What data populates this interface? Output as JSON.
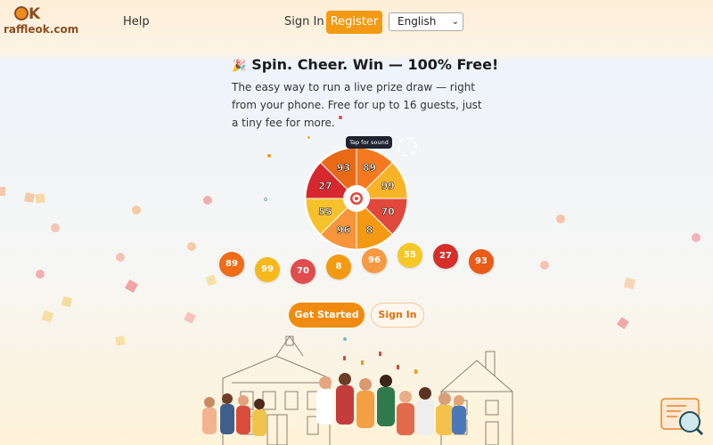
{
  "header": {
    "logo_text": "raffleok.com",
    "logo_mark": "K",
    "help_label": "Help",
    "signin_label": "Sign In",
    "register_label": "Register",
    "language": "English"
  },
  "hero": {
    "party_icon": "🎉",
    "title": "Spin. Cheer. Win — 100% Free!",
    "subtitle": "The easy way to run a live prize draw — right from your phone. Free for up to 16 guests, just a tiny fee for more."
  },
  "wheel": {
    "tooltip": "Tap for sound",
    "segments": [
      {
        "value": "89",
        "color": "#f4791f"
      },
      {
        "value": "99",
        "color": "#f9b326"
      },
      {
        "value": "70",
        "color": "#e0483c"
      },
      {
        "value": "8",
        "color": "#f39a12"
      },
      {
        "value": "96",
        "color": "#f69539"
      },
      {
        "value": "55",
        "color": "#f6c22c"
      },
      {
        "value": "27",
        "color": "#d7282f"
      },
      {
        "value": "93",
        "color": "#e86a16"
      }
    ]
  },
  "chips": [
    {
      "value": "89",
      "color": "#f06c17"
    },
    {
      "value": "99",
      "color": "#f7b81c"
    },
    {
      "value": "70",
      "color": "#e14c4c"
    },
    {
      "value": "8",
      "color": "#f39a12"
    },
    {
      "value": "96",
      "color": "#f59a43"
    },
    {
      "value": "55",
      "color": "#f7c726"
    },
    {
      "value": "27",
      "color": "#d62f2a"
    },
    {
      "value": "93",
      "color": "#ea5b17"
    }
  ],
  "cta": {
    "get_started": "Get Started",
    "sign_in": "Sign In"
  }
}
